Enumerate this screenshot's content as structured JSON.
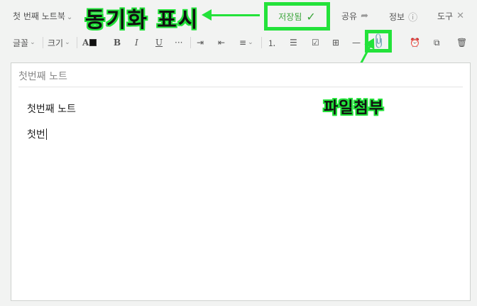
{
  "header": {
    "notebook": "첫 번째 노트북",
    "saved_label": "저장됨",
    "share_label": "공유",
    "info_label": "정보",
    "tools_label": "도구"
  },
  "toolbar": {
    "font_label": "글꼴",
    "size_label": "크기",
    "color_label": "A",
    "bold_label": "B",
    "italic_label": "I",
    "underline_label": "U",
    "more_label": "···",
    "hr_label": "—"
  },
  "note": {
    "title": "첫번째 노트",
    "lines": [
      "첫번째 노트",
      "첫번"
    ]
  },
  "annotations": {
    "sync": "동기화 표시",
    "attach": "파일첨부"
  },
  "colors": {
    "highlight": "#23e23a",
    "saved": "#3aa53a"
  }
}
